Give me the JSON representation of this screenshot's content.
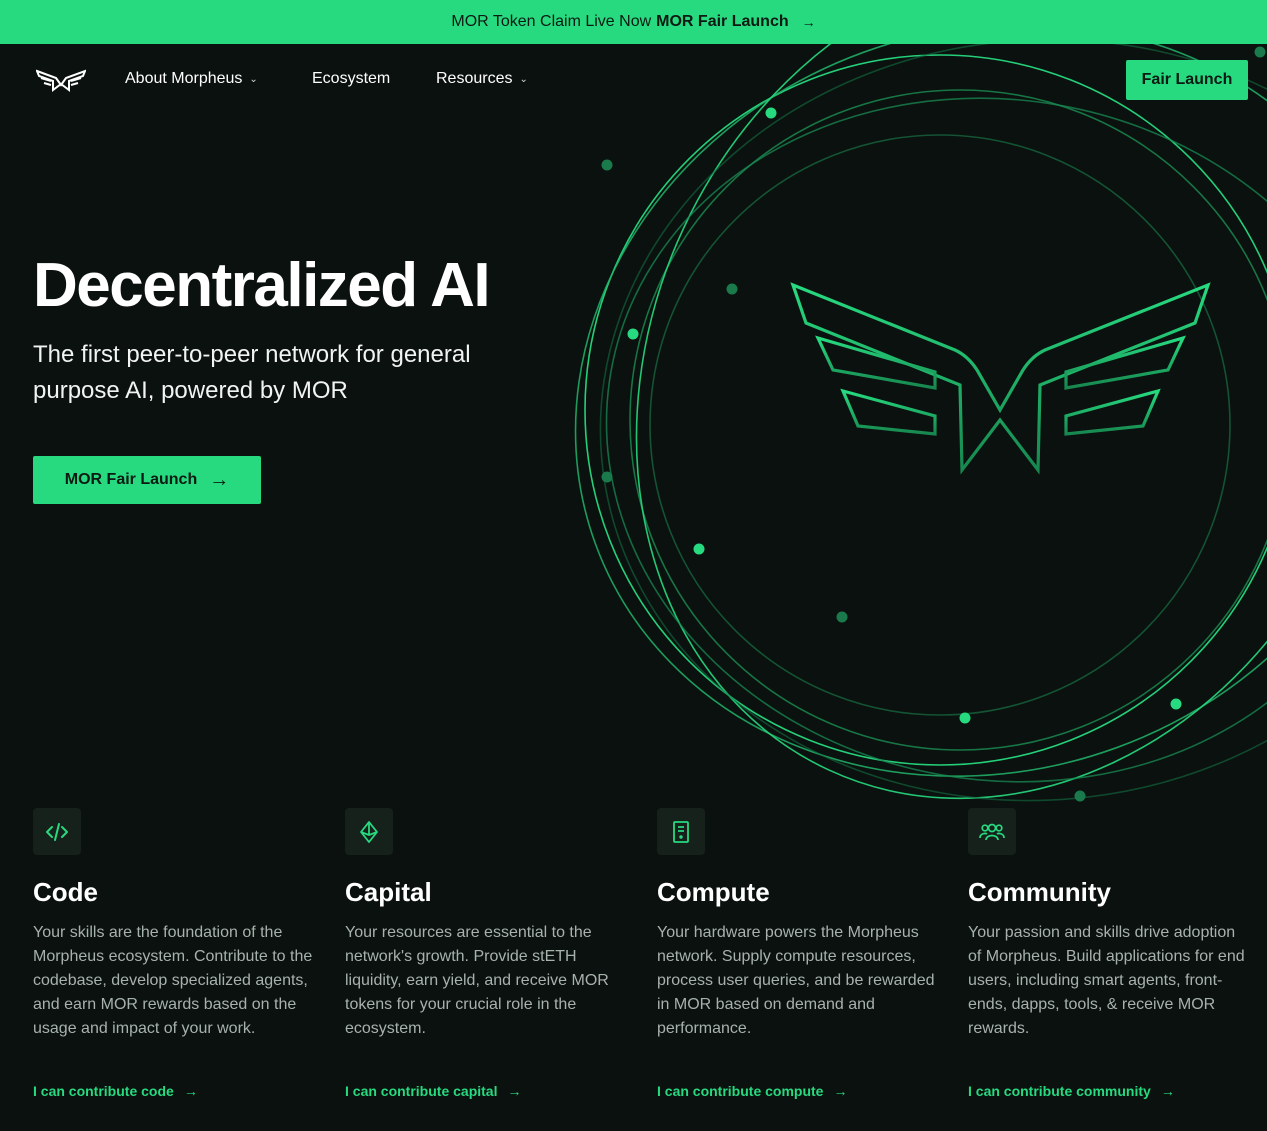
{
  "colors": {
    "accent": "#27da80",
    "background": "#0a110e",
    "muted_text": "#a8b2ad"
  },
  "banner": {
    "text": "MOR Token Claim Live Now",
    "link_label": "MOR Fair Launch",
    "arrow_icon": "arrow-right-icon"
  },
  "nav": {
    "logo_icon": "morpheus-logo",
    "items": [
      {
        "label": "About Morpheus",
        "has_dropdown": true
      },
      {
        "label": "Ecosystem",
        "has_dropdown": false
      },
      {
        "label": "Resources",
        "has_dropdown": true
      }
    ],
    "cta_label": "Fair Launch"
  },
  "hero": {
    "title": "Decentralized AI",
    "subtitle": "The first peer-to-peer network for general purpose AI, powered by MOR",
    "button_label": "MOR Fair Launch"
  },
  "cards": [
    {
      "icon": "code-icon",
      "title": "Code",
      "description": "Your skills are the foundation of the Morpheus ecosystem. Contribute to the codebase, develop specialized agents, and earn MOR rewards based on the usage and impact of your work.",
      "link": "I can contribute code"
    },
    {
      "icon": "ethereum-icon",
      "title": "Capital",
      "description": "Your resources are essential to the network's growth. Provide stETH liquidity, earn yield, and receive MOR tokens for your crucial role in the ecosystem.",
      "link": "I can contribute capital"
    },
    {
      "icon": "server-icon",
      "title": "Compute",
      "description": "Your hardware powers the Morpheus network. Supply compute resources, process user queries, and be rewarded in MOR based on demand and performance.",
      "link": "I can contribute compute"
    },
    {
      "icon": "users-icon",
      "title": "Community",
      "description": "Your passion and skills drive adoption of Morpheus. Build applications for end users, including smart agents, front-ends, dapps, tools, & receive MOR rewards.",
      "link": "I can contribute community"
    }
  ]
}
